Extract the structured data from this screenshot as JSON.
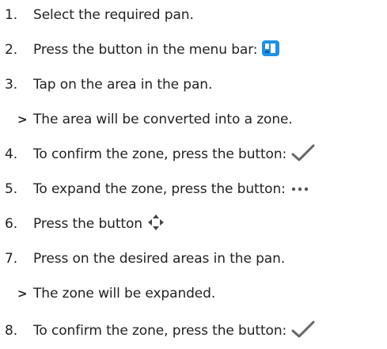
{
  "steps": [
    {
      "marker": "1.",
      "text": "Select the required pan."
    },
    {
      "marker": "2.",
      "text": "Press the button in the menu bar:",
      "icon": "zone-tool-icon",
      "icon_color": "#1e90e6"
    },
    {
      "marker": "3.",
      "text": "Tap on the area in the pan."
    },
    {
      "marker": ">",
      "text": "The area will be converted into a zone."
    },
    {
      "marker": "4.",
      "text": "To confirm the zone, press the button:",
      "icon": "checkmark-icon"
    },
    {
      "marker": "5.",
      "text": "To expand the zone, press the button:",
      "icon": "more-dots-icon"
    },
    {
      "marker": "6.",
      "text": "Press the button",
      "icon": "move-arrows-icon"
    },
    {
      "marker": "7.",
      "text": "Press on the desired areas in the pan."
    },
    {
      "marker": ">",
      "text": "The zone will be expanded."
    },
    {
      "marker": "8.",
      "text": "To confirm the zone, press the button:",
      "icon": "checkmark-icon"
    }
  ],
  "colors": {
    "text": "#222222",
    "accent": "#1e90e6",
    "icon_gray": "#666666"
  }
}
